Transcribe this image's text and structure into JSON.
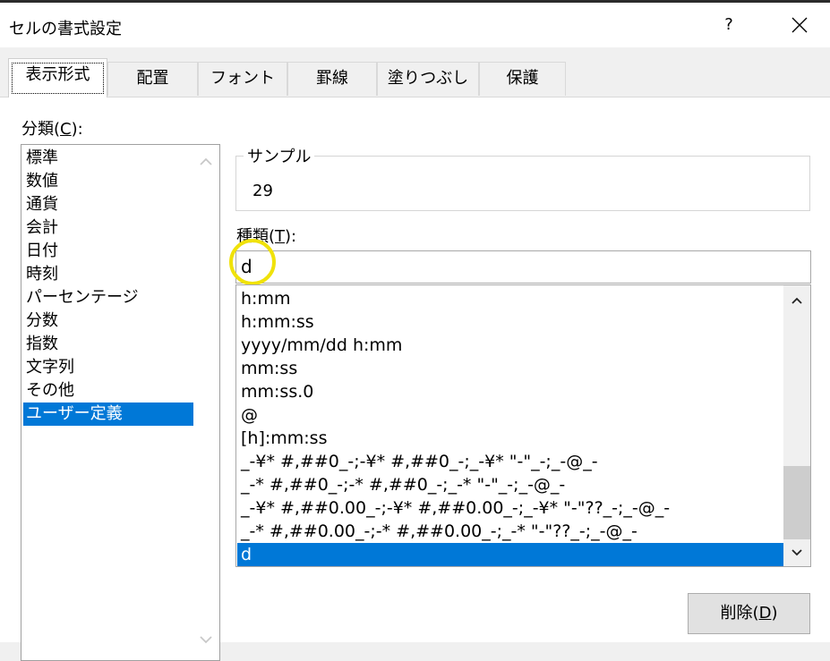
{
  "window": {
    "title": "セルの書式設定",
    "help_label": "?"
  },
  "tabs": [
    {
      "label": "表示形式"
    },
    {
      "label": "配置"
    },
    {
      "label": "フォント"
    },
    {
      "label": "罫線"
    },
    {
      "label": "塗りつぶし"
    },
    {
      "label": "保護"
    }
  ],
  "category": {
    "label_prefix": "分類(",
    "label_key": "C",
    "label_suffix": "):",
    "items": [
      "標準",
      "数値",
      "通貨",
      "会計",
      "日付",
      "時刻",
      "パーセンテージ",
      "分数",
      "指数",
      "文字列",
      "その他",
      "ユーザー定義"
    ],
    "selected": "ユーザー定義"
  },
  "sample": {
    "label": "サンプル",
    "value": "29"
  },
  "type": {
    "label_prefix": "種類(",
    "label_key": "T",
    "label_suffix": "):",
    "input_value": "d",
    "formats": [
      "h:mm",
      "h:mm:ss",
      "yyyy/mm/dd h:mm",
      "mm:ss",
      "mm:ss.0",
      "@",
      "[h]:mm:ss",
      "_-¥* #,##0_-;-¥* #,##0_-;_-¥* \"-\"_-;_-@_-",
      "_-* #,##0_-;-* #,##0_-;_-* \"-\"_-;_-@_-",
      "_-¥* #,##0.00_-;-¥* #,##0.00_-;_-¥* \"-\"??_-;_-@_-",
      "_-* #,##0.00_-;-* #,##0.00_-;_-* \"-\"??_-;_-@_-",
      "d"
    ],
    "selected": "d"
  },
  "delete_button": {
    "label_prefix": "削除(",
    "label_key": "D",
    "label_suffix": ")"
  },
  "colors": {
    "selection": "#0078d7",
    "highlight_circle": "#f0e20a"
  }
}
